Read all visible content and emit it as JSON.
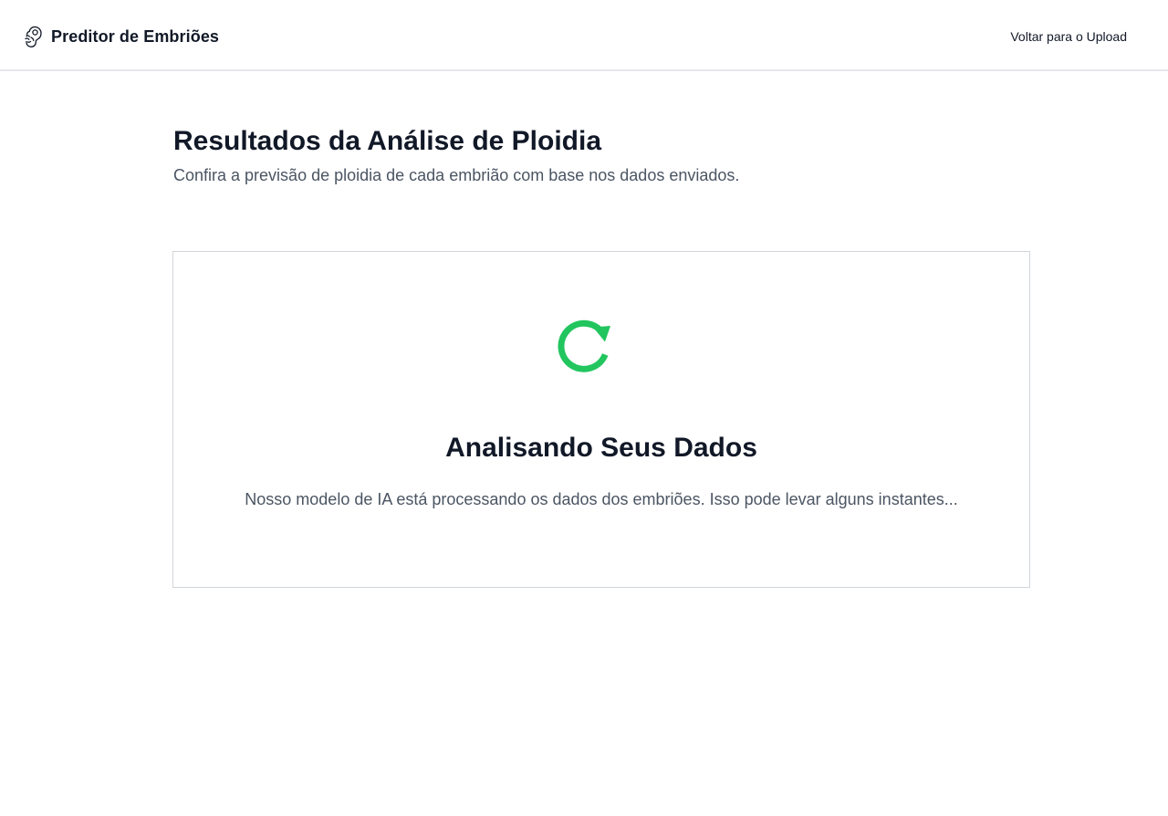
{
  "header": {
    "brand_icon": "embryo-icon",
    "brand_title": "Preditor de Embriões",
    "back_link": "Voltar para o Upload"
  },
  "main": {
    "title": "Resultados da Análise de Ploidia",
    "subtitle": "Confira a previsão de ploidia de cada embrião com base nos dados enviados."
  },
  "status": {
    "icon": "refresh-icon",
    "icon_color": "#22c55e",
    "title": "Analisando Seus Dados",
    "message": "Nosso modelo de IA está processando os dados dos embriões. Isso pode levar alguns instantes..."
  }
}
